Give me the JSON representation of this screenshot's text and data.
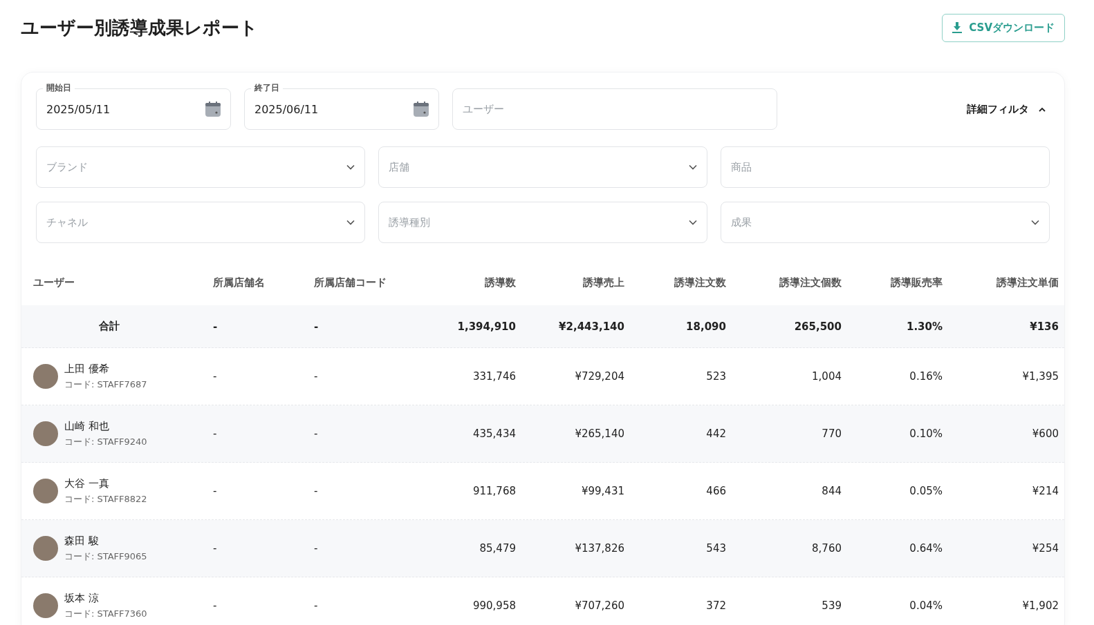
{
  "title": "ユーザー別誘導成果レポート",
  "csv_button": {
    "label": "CSVダウンロード"
  },
  "filters": [
    {
      "kind": "date",
      "label": "開始日",
      "value": "2025/05/11"
    },
    {
      "kind": "date",
      "label": "終了日",
      "value": "2025/06/11"
    },
    {
      "kind": "text",
      "placeholder": "ユーザー"
    }
  ],
  "detail_toggle": {
    "label": "詳細フィルタ",
    "expanded": true
  },
  "detail_filters": [
    {
      "kind": "select",
      "placeholder": "ブランド"
    },
    {
      "kind": "select",
      "placeholder": "店舗"
    },
    {
      "kind": "text",
      "placeholder": "商品"
    },
    {
      "kind": "select",
      "placeholder": "チャネル"
    },
    {
      "kind": "select",
      "placeholder": "誘導種別"
    },
    {
      "kind": "select",
      "placeholder": "成果"
    }
  ],
  "table": {
    "columns": [
      "ユーザー",
      "所属店舗名",
      "所属店舗コード",
      "誘導数",
      "誘導売上",
      "誘導注文数",
      "誘導注文個数",
      "誘導販売率",
      "誘導注文単価"
    ],
    "rows": [
      {
        "kind": "total",
        "cells": [
          "合計",
          "-",
          "-",
          "1,394,910",
          "¥2,443,140",
          "18,090",
          "265,500",
          "1.30%",
          "¥136"
        ]
      },
      {
        "kind": "user",
        "cells": [
          {
            "name": "上田 優希",
            "code": "コード: STAFF7687"
          },
          "-",
          "-",
          "331,746",
          "¥729,204",
          "523",
          "1,004",
          "0.16%",
          "¥1,395"
        ]
      },
      {
        "kind": "user",
        "cells": [
          {
            "name": "山崎 和也",
            "code": "コード: STAFF9240"
          },
          "-",
          "-",
          "435,434",
          "¥265,140",
          "442",
          "770",
          "0.10%",
          "¥600"
        ]
      },
      {
        "kind": "user",
        "cells": [
          {
            "name": "大谷 一真",
            "code": "コード: STAFF8822"
          },
          "-",
          "-",
          "911,768",
          "¥99,431",
          "466",
          "844",
          "0.05%",
          "¥214"
        ]
      },
      {
        "kind": "user",
        "cells": [
          {
            "name": "森田 駿",
            "code": "コード: STAFF9065"
          },
          "-",
          "-",
          "85,479",
          "¥137,826",
          "543",
          "8,760",
          "0.64%",
          "¥254"
        ]
      },
      {
        "kind": "user",
        "cells": [
          {
            "name": "坂本 涼",
            "code": "コード: STAFF7360"
          },
          "-",
          "-",
          "990,958",
          "¥707,260",
          "372",
          "539",
          "0.04%",
          "¥1,902"
        ]
      }
    ]
  }
}
